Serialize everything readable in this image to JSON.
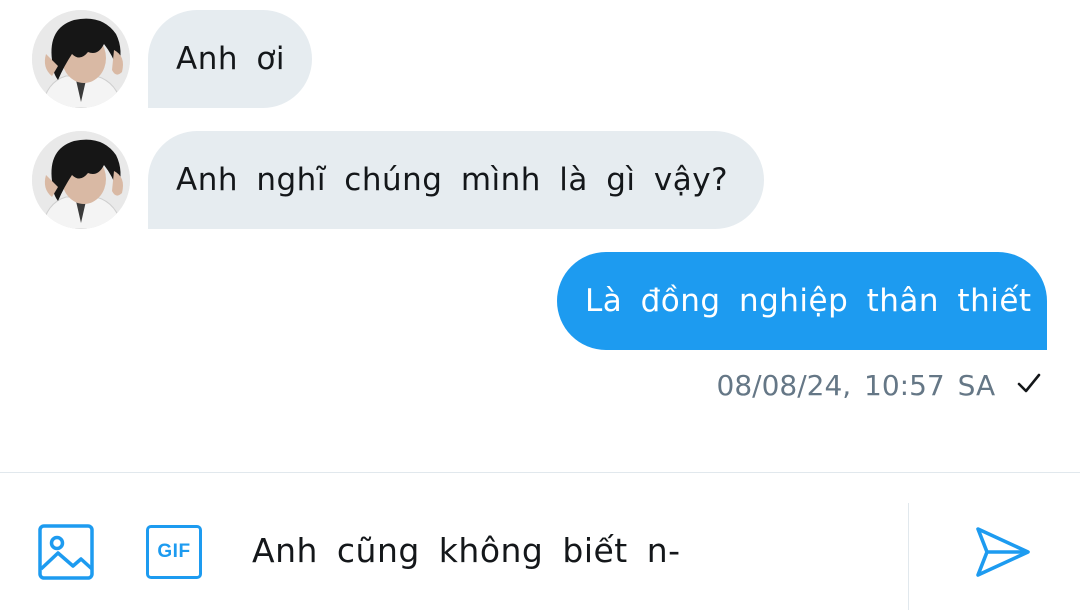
{
  "colors": {
    "accent": "#1d9bf0",
    "incoming_bubble": "#e6ecf0",
    "meta_text": "#657786"
  },
  "messages": [
    {
      "direction": "incoming",
      "text": "Anh ơi",
      "avatar": "user-avatar-photo"
    },
    {
      "direction": "incoming",
      "text": "Anh nghĩ chúng mình là gì vậy?",
      "avatar": "user-avatar-photo"
    },
    {
      "direction": "outgoing",
      "text": "Là đồng nghiệp thân thiết",
      "timestamp": "08/08/24, 10:57 SA",
      "status_icon": "check-icon"
    }
  ],
  "composer": {
    "image_icon": "image-icon",
    "gif_label": "GIF",
    "draft_text": "Anh cũng không biết n-",
    "send_icon": "send-icon"
  }
}
